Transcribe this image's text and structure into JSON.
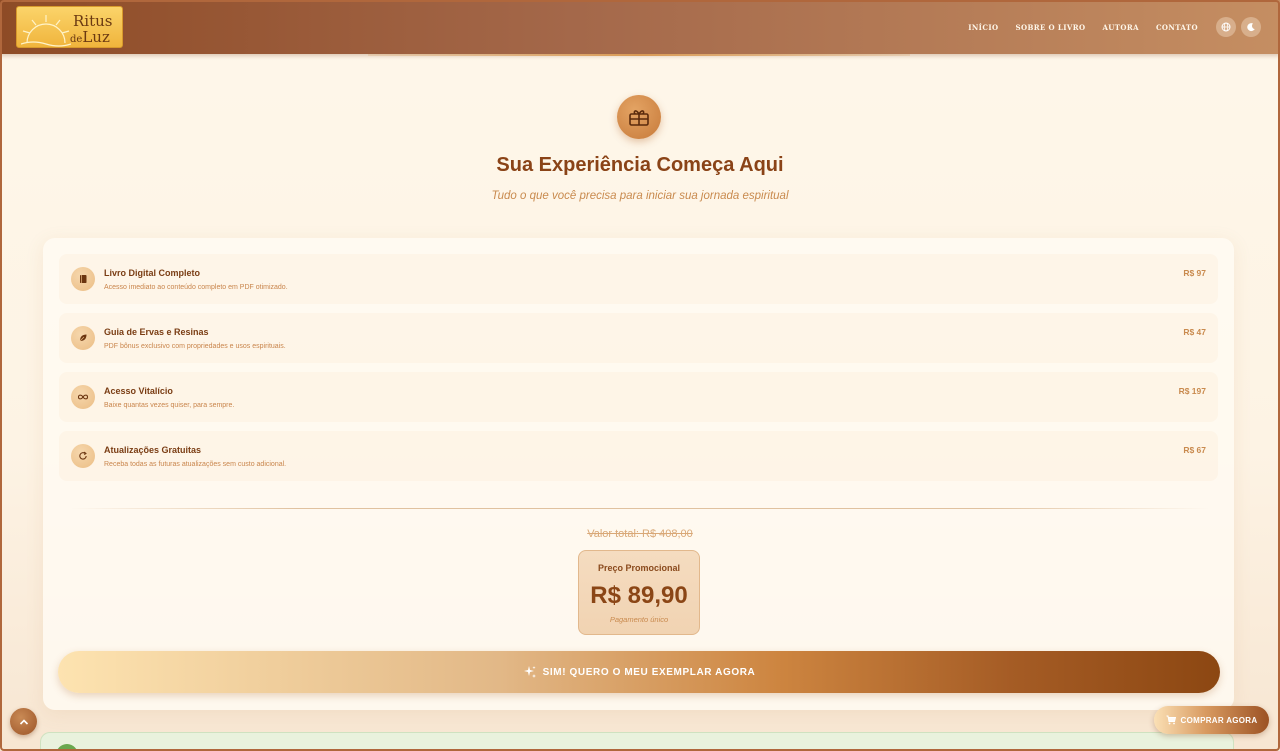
{
  "header": {
    "logo": {
      "line1": "Ritus",
      "line2_prefix": "de",
      "line2": "Luz"
    },
    "nav": [
      "INÍCIO",
      "SOBRE O LIVRO",
      "AUTORA",
      "CONTATO"
    ],
    "language_icon": "globe-icon",
    "theme_icon": "moon-icon"
  },
  "hero": {
    "icon": "gift-icon",
    "title": "Sua Experiência Começa Aqui",
    "subtitle": "Tudo o que você precisa para iniciar sua jornada espiritual"
  },
  "items": [
    {
      "icon": "book-icon",
      "title": "Livro Digital Completo",
      "desc": "Acesso imediato ao conteúdo completo em PDF otimizado.",
      "price": "R$ 97"
    },
    {
      "icon": "leaf-icon",
      "title": "Guia de Ervas e Resinas",
      "desc": "PDF bônus exclusivo com propriedades e usos espirituais.",
      "price": "R$ 47"
    },
    {
      "icon": "infinity-icon",
      "title": "Acesso Vitalício",
      "desc": "Baixe quantas vezes quiser, para sempre.",
      "price": "R$ 197"
    },
    {
      "icon": "refresh-icon",
      "title": "Atualizações Gratuitas",
      "desc": "Receba todas as futuras atualizações sem custo adicional.",
      "price": "R$ 67"
    }
  ],
  "pricing": {
    "total": "Valor total: R$ 408,00",
    "promo_label": "Preço Promocional",
    "promo_price": "R$ 89,90",
    "promo_note": "Pagamento único"
  },
  "cta": {
    "label": "SIM! QUERO O MEU EXEMPLAR AGORA",
    "icon": "sparkle-icon"
  },
  "floating": {
    "buy_label": "COMPRAR AGORA",
    "buy_icon": "cart-icon",
    "scroll_icon": "chevron-up-icon"
  },
  "colors": {
    "brand": "#8b4616",
    "accent": "#cd8540",
    "header": "#a4684a"
  }
}
